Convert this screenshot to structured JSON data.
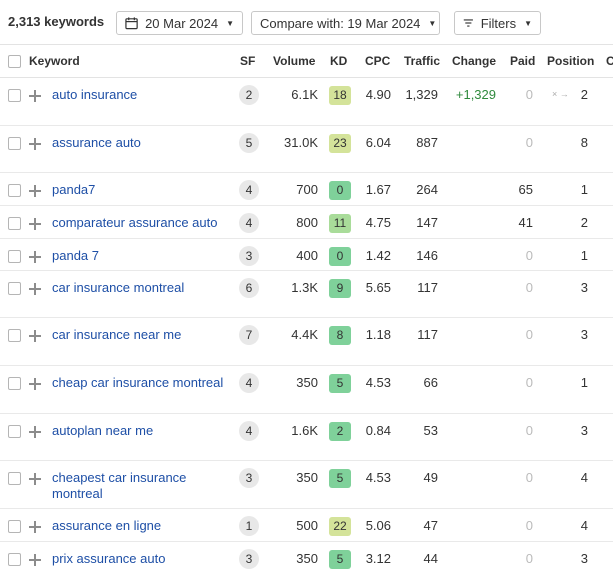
{
  "toolbar": {
    "keyword_count": "2,313 keywords",
    "date": "20 Mar 2024",
    "compare": "Compare with: 19 Mar 2024",
    "filters": "Filters"
  },
  "columns": {
    "keyword": "Keyword",
    "sf": "SF",
    "volume": "Volume",
    "kd": "KD",
    "cpc": "CPC",
    "traffic": "Traffic",
    "change": "Change",
    "paid": "Paid",
    "position": "Position",
    "extra": "C"
  },
  "colors": {
    "link": "#1e4fa6",
    "kd_green_dark": "#7fd19a",
    "kd_yellow": "#d4e39a",
    "change_positive": "#2f8a3d"
  },
  "rows": [
    {
      "keyword": "auto insurance",
      "sf": "2",
      "volume": "6.1K",
      "kd": "18",
      "kd_color": "#d4e39a",
      "cpc": "4.90",
      "traffic": "1,329",
      "change": "+1,329",
      "paid": "0",
      "position": "2",
      "position_prev": "× →"
    },
    {
      "keyword": "assurance auto",
      "sf": "5",
      "volume": "31.0K",
      "kd": "23",
      "kd_color": "#d4e39a",
      "cpc": "6.04",
      "traffic": "887",
      "change": "",
      "paid": "0",
      "position": "8",
      "position_prev": ""
    },
    {
      "keyword": "panda7",
      "sf": "4",
      "volume": "700",
      "kd": "0",
      "kd_color": "#7fd19a",
      "cpc": "1.67",
      "traffic": "264",
      "change": "",
      "paid": "65",
      "position": "1",
      "position_prev": ""
    },
    {
      "keyword": "comparateur assurance auto",
      "sf": "4",
      "volume": "800",
      "kd": "11",
      "kd_color": "#a9dc9a",
      "cpc": "4.75",
      "traffic": "147",
      "change": "",
      "paid": "41",
      "position": "2",
      "position_prev": ""
    },
    {
      "keyword": "panda 7",
      "sf": "3",
      "volume": "400",
      "kd": "0",
      "kd_color": "#7fd19a",
      "cpc": "1.42",
      "traffic": "146",
      "change": "",
      "paid": "0",
      "position": "1",
      "position_prev": ""
    },
    {
      "keyword": "car insurance montreal",
      "sf": "6",
      "volume": "1.3K",
      "kd": "9",
      "kd_color": "#7fd19a",
      "cpc": "5.65",
      "traffic": "117",
      "change": "",
      "paid": "0",
      "position": "3",
      "position_prev": ""
    },
    {
      "keyword": "car insurance near me",
      "sf": "7",
      "volume": "4.4K",
      "kd": "8",
      "kd_color": "#7fd19a",
      "cpc": "1.18",
      "traffic": "117",
      "change": "",
      "paid": "0",
      "position": "3",
      "position_prev": ""
    },
    {
      "keyword": "cheap car insurance montreal",
      "sf": "4",
      "volume": "350",
      "kd": "5",
      "kd_color": "#7fd19a",
      "cpc": "4.53",
      "traffic": "66",
      "change": "",
      "paid": "0",
      "position": "1",
      "position_prev": ""
    },
    {
      "keyword": "autoplan near me",
      "sf": "4",
      "volume": "1.6K",
      "kd": "2",
      "kd_color": "#7fd19a",
      "cpc": "0.84",
      "traffic": "53",
      "change": "",
      "paid": "0",
      "position": "3",
      "position_prev": ""
    },
    {
      "keyword": "cheapest car insurance montreal",
      "sf": "3",
      "volume": "350",
      "kd": "5",
      "kd_color": "#7fd19a",
      "cpc": "4.53",
      "traffic": "49",
      "change": "",
      "paid": "0",
      "position": "4",
      "position_prev": ""
    },
    {
      "keyword": "assurance en ligne",
      "sf": "1",
      "volume": "500",
      "kd": "22",
      "kd_color": "#d4e39a",
      "cpc": "5.06",
      "traffic": "47",
      "change": "",
      "paid": "0",
      "position": "4",
      "position_prev": ""
    },
    {
      "keyword": "prix assurance auto",
      "sf": "3",
      "volume": "350",
      "kd": "5",
      "kd_color": "#7fd19a",
      "cpc": "3.12",
      "traffic": "44",
      "change": "",
      "paid": "0",
      "position": "3",
      "position_prev": ""
    }
  ]
}
